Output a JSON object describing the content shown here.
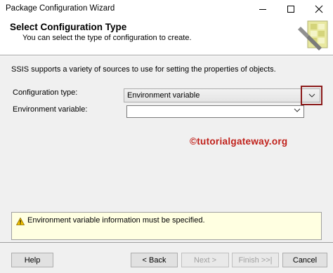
{
  "window": {
    "title": "Package Configuration Wizard"
  },
  "header": {
    "title": "Select Configuration Type",
    "subtitle": "You can select the type of configuration to create."
  },
  "content": {
    "intro": "SSIS supports a variety of sources to use for setting the properties of objects.",
    "configuration_type_label": "Configuration type:",
    "configuration_type_value": "Environment variable",
    "environment_variable_label": "Environment variable:",
    "environment_variable_value": "",
    "watermark": "©tutorialgateway.org"
  },
  "message": {
    "text": "Environment variable information must be specified."
  },
  "buttons": {
    "help": "Help",
    "back": "< Back",
    "next": "Next >",
    "finish": "Finish >>|",
    "cancel": "Cancel"
  },
  "colors": {
    "highlight_border": "#8b1a1a",
    "watermark": "#c0201a",
    "message_bg": "#ffffe1",
    "dialog_bg": "#f0f0f0"
  }
}
